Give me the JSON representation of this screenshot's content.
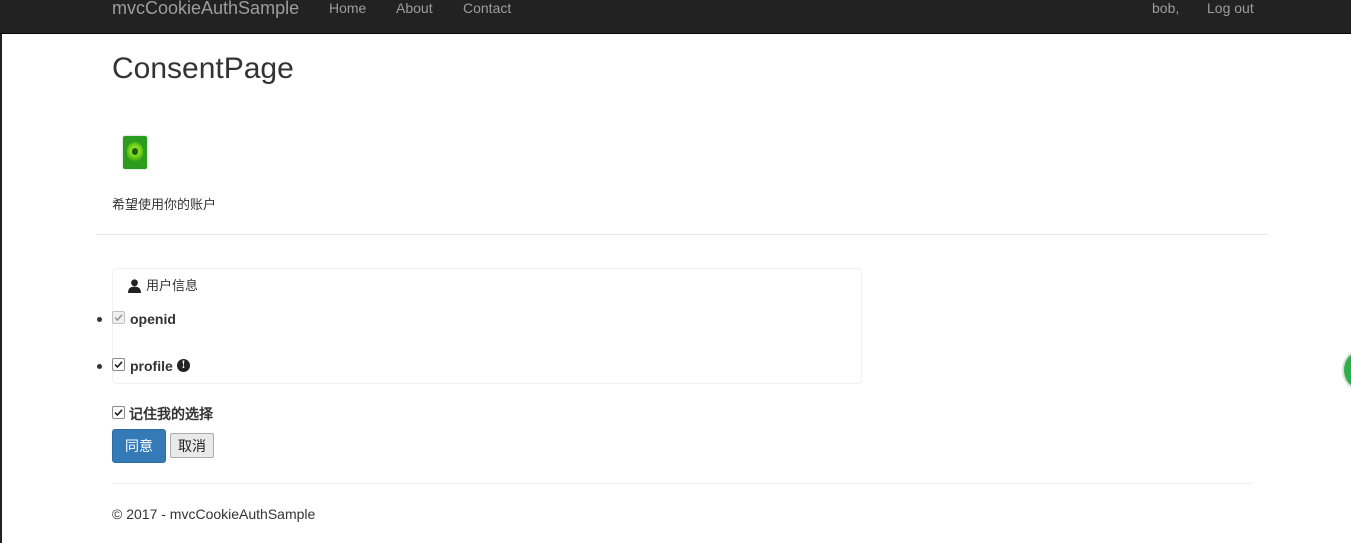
{
  "navbar": {
    "brand": "mvcCookieAuthSample",
    "links": [
      {
        "label": "Home"
      },
      {
        "label": "About"
      },
      {
        "label": "Contact"
      }
    ],
    "user": "bob,",
    "logout": "Log out"
  },
  "page": {
    "title": "ConsentPage",
    "consent_text": "希望使用你的账户"
  },
  "scopes": {
    "heading": "用户信息",
    "heading_icon": "user-icon",
    "items": [
      {
        "label": "openid",
        "checked": true,
        "disabled": true
      },
      {
        "label": "profile",
        "checked": true,
        "disabled": false,
        "icon": "info-icon"
      }
    ]
  },
  "remember": {
    "label": "记住我的选择",
    "checked": true
  },
  "buttons": {
    "agree": "同意",
    "cancel": "取消"
  },
  "footer": {
    "text": "© 2017 - mvcCookieAuthSample"
  },
  "colors": {
    "navbar_bg": "#222222",
    "nav_text": "#9d9d9d",
    "primary": "#337ab7",
    "text": "#333333"
  }
}
